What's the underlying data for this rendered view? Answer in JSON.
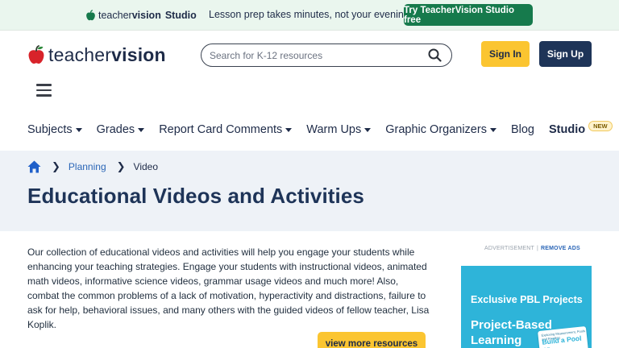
{
  "promo": {
    "logo_prefix": "teacher",
    "logo_bold": "vision",
    "logo_suffix": "Studio",
    "tagline": "Lesson prep takes minutes, not your evening.",
    "cta": "Try TeacherVision Studio free"
  },
  "header": {
    "logo_prefix": "teacher",
    "logo_bold": "vision",
    "search_placeholder": "Search for K-12 resources",
    "signin": "Sign In",
    "signup": "Sign Up"
  },
  "nav": {
    "items": [
      {
        "label": "Subjects",
        "dropdown": true
      },
      {
        "label": "Grades",
        "dropdown": true
      },
      {
        "label": "Report Card Comments",
        "dropdown": true
      },
      {
        "label": "Warm Ups",
        "dropdown": true
      },
      {
        "label": "Graphic Organizers",
        "dropdown": true
      },
      {
        "label": "Blog",
        "dropdown": false
      }
    ],
    "studio": "Studio",
    "studio_badge": "NEW"
  },
  "breadcrumb": {
    "planning": "Planning",
    "current": "Video"
  },
  "page": {
    "title": "Educational Videos and Activities",
    "intro": "Our collection of educational videos and activities will help you engage your students while enhancing your teaching strategies. Engage your students with instructional videos, animated math videos, informative science videos, grammar usage videos and much more! Also, combat the common problems of a lack of motivation, hyperactivity and distractions, failure to ask for help, behavioral issues, and many others with the guided videos of fellow teacher, Lisa Koplik.",
    "more_button": "view more resources"
  },
  "ad": {
    "label": "ADVERTISEMENT",
    "remove": "REMOVE ADS",
    "headline": "Exclusive PBL Projects",
    "subhead": "Project-Based Learning",
    "card_small": "Exploring Measurement, Pools and Reading",
    "card_big": "Build a Pool or"
  },
  "colors": {
    "brand_navy": "#1e3458",
    "accent_yellow": "#fbc531",
    "promo_green": "#167a4c",
    "apple_red": "#d8232a",
    "link_blue": "#2b66b7",
    "ad_teal": "#2eb4d9"
  }
}
